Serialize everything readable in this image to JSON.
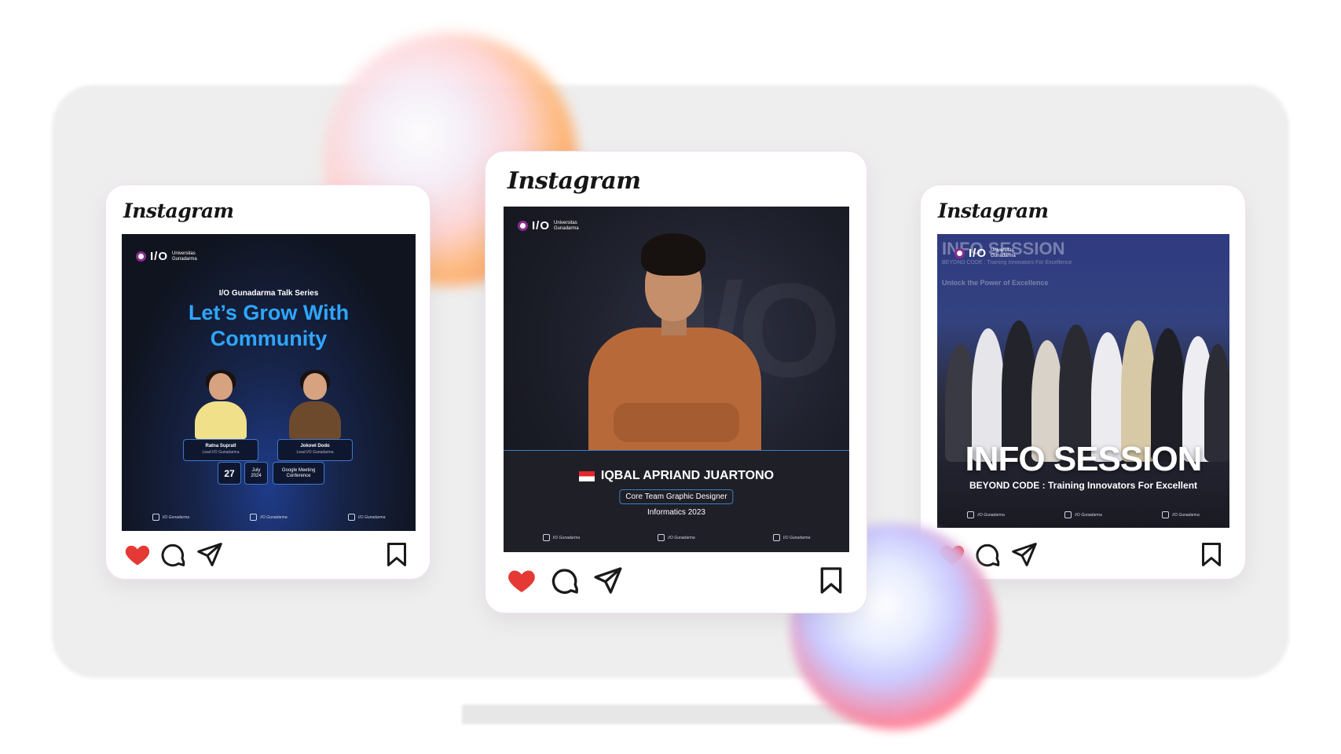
{
  "colors": {
    "heart": "#e53935",
    "accent_blue": "#2fa6ff",
    "icon": "#1a1a1a"
  },
  "cards": [
    {
      "id": "left",
      "logo": "Instagram",
      "post": {
        "brand_mark": "I/O",
        "brand_sub": "Universitas Gunadarma",
        "series": "I/O Gunadarma Talk Series",
        "title_line1": "Let’s Grow With",
        "title_line2": "Community",
        "speakers": [
          {
            "name": "Ratna Supratl",
            "role": "Lead I/O Gunadarma"
          },
          {
            "name": "Jokowi Dodo",
            "role": "Lead I/O Gunadarma"
          }
        ],
        "date_day": "27",
        "date_month": "July",
        "date_year": "2024",
        "platform_line1": "Google Meeting",
        "platform_line2": "Conference",
        "socials": [
          "I/O Gunadarma",
          "I/O Gunadarma",
          "I/O Gunadarma"
        ]
      },
      "actions": [
        "heart-icon",
        "comment-icon",
        "share-icon",
        "bookmark-icon"
      ]
    },
    {
      "id": "center",
      "logo": "Instagram",
      "post": {
        "brand_mark": "I/O",
        "brand_sub": "Universitas Gunadarma",
        "name": "IQBAL APRIAND JUARTONO",
        "role": "Core Team Graphic Designer",
        "year": "Informatics 2023",
        "socials": [
          "I/O Gunadarma",
          "I/O Gunadarma",
          "I/O Gunadarma"
        ]
      },
      "actions": [
        "heart-icon",
        "comment-icon",
        "share-icon",
        "bookmark-icon"
      ]
    },
    {
      "id": "right",
      "logo": "Instagram",
      "post": {
        "brand_mark": "I/O",
        "brand_sub": "Universitas Gunadarma",
        "ghost_title": "INFO SESSION",
        "ghost_sub": "BEYOND CODE : Training Innovators For Excellence",
        "ghost_unlock": "Unlock the Power of Excellence",
        "title": "INFO SESSION",
        "subtitle": "BEYOND CODE : Training Innovators For Excellent",
        "socials": [
          "I/O Gunadarma",
          "I/O Gunadarma",
          "I/O Gunadarma"
        ]
      },
      "actions": [
        "heart-icon",
        "comment-icon",
        "share-icon",
        "bookmark-icon"
      ]
    }
  ]
}
